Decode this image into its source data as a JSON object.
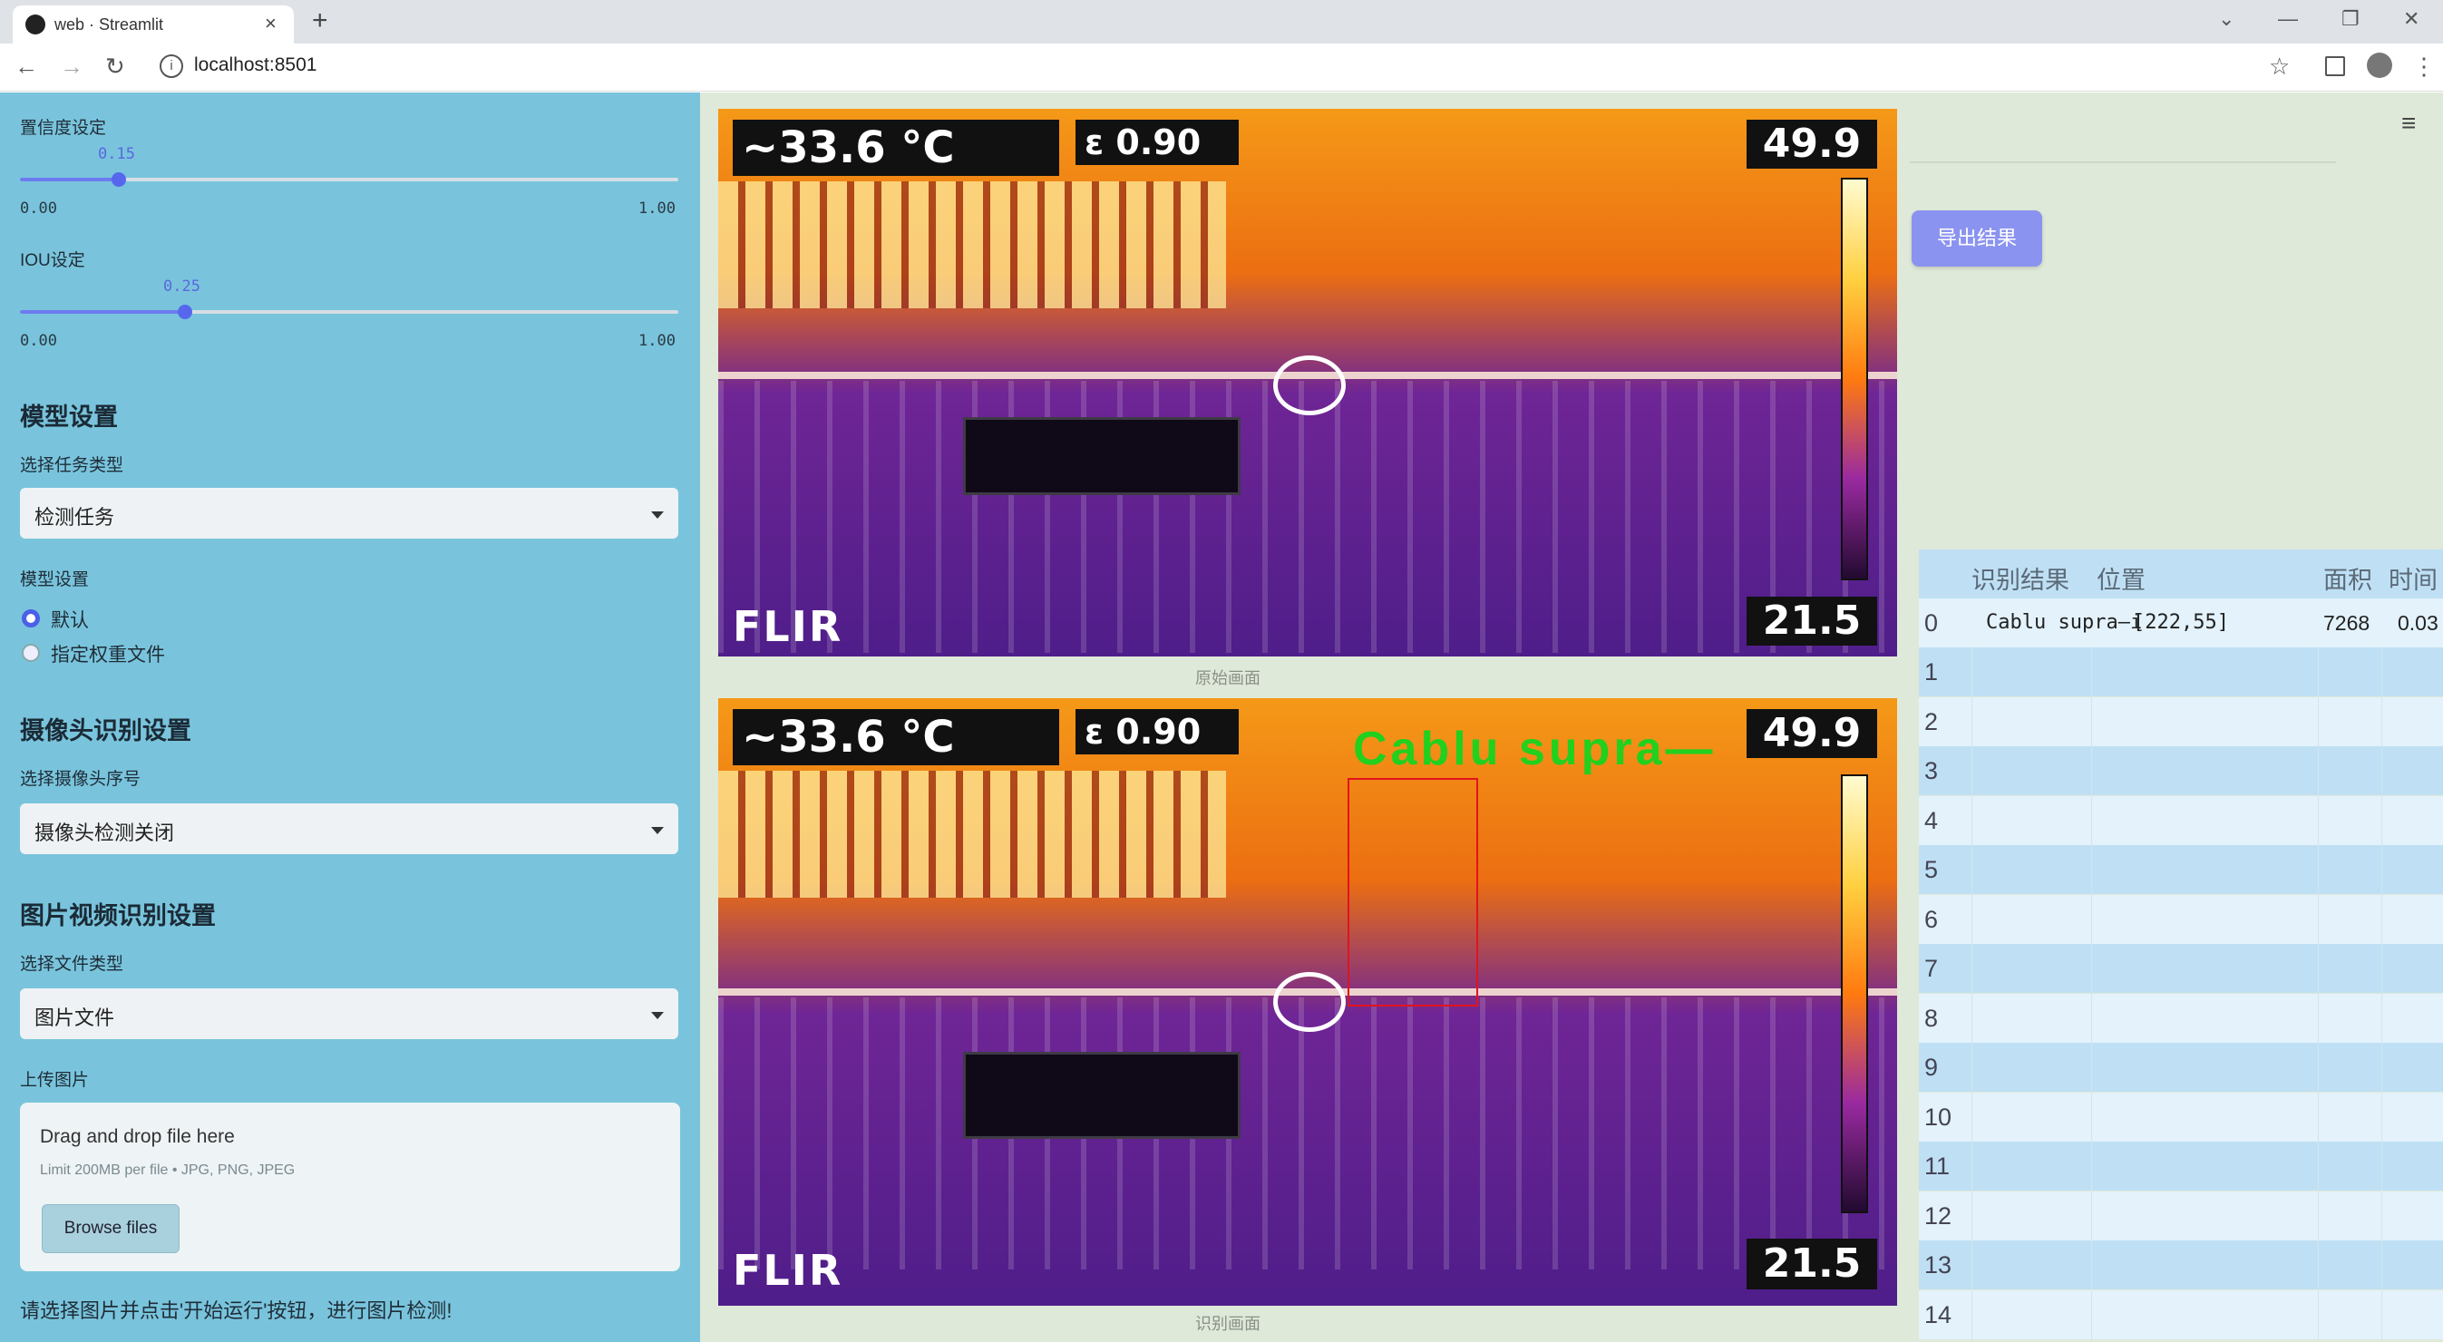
{
  "browser": {
    "tab_title": "web · Streamlit",
    "tab_close": "×",
    "new_tab": "+",
    "url": "localhost:8501",
    "icons": [
      "back-icon",
      "forward-icon",
      "reload-icon",
      "info-icon",
      "star-icon",
      "sidepanel-icon",
      "profile-icon",
      "menu-icon"
    ]
  },
  "sidebar": {
    "confidence": {
      "label": "置信度设定",
      "value": "0.15",
      "min": "0.00",
      "max": "1.00",
      "fraction": 0.15
    },
    "iou": {
      "label": "IOU设定",
      "value": "0.25",
      "min": "0.00",
      "max": "1.00",
      "fraction": 0.25
    },
    "model_section": {
      "title": "模型设置",
      "task_label": "选择任务类型",
      "task_value": "检测任务",
      "model_label": "模型设置",
      "options": [
        "默认",
        "指定权重文件"
      ],
      "selected": 0
    },
    "camera_section": {
      "title": "摄像头识别设置",
      "camera_label": "选择摄像头序号",
      "camera_value": "摄像头检测关闭"
    },
    "media_section": {
      "title": "图片视频识别设置",
      "file_type_label": "选择文件类型",
      "file_type_value": "图片文件",
      "upload_label": "上传图片",
      "drop_text": "Drag and drop file here",
      "limit_text": "Limit 200MB per file • JPG, PNG, JPEG",
      "browse_label": "Browse files"
    },
    "hint": "请选择图片并点击'开始运行'按钮，进行图片检测!"
  },
  "main": {
    "original": {
      "temp": "~33.6 °C",
      "emissivity": "ε 0.90",
      "max": "49.9",
      "min": "21.5",
      "brand": "FLIR",
      "caption": "原始画面"
    },
    "detected": {
      "temp": "~33.6 °C",
      "emissivity": "ε 0.90",
      "max": "49.9",
      "min": "21.5",
      "brand": "FLIR",
      "label": "Cablu supra—",
      "caption": "识别画面"
    },
    "export_label": "导出结果",
    "table": {
      "headers": [
        "",
        "识别结果",
        "位置",
        "面积",
        "时间"
      ],
      "row0": {
        "index": "0",
        "result": "Cablu supra—i",
        "position": "[222,55]",
        "area": "7268",
        "time": "0.03"
      },
      "indices": [
        "1",
        "2",
        "3",
        "4",
        "5",
        "6",
        "7",
        "8",
        "9",
        "10",
        "11",
        "12",
        "13",
        "14"
      ]
    }
  },
  "colors": {
    "sidebar_bg": "#79c4dc",
    "main_bg": "#dfe9d9",
    "accent": "#5667ee",
    "detect_box": "#e0141e",
    "detect_label": "#22d01e"
  }
}
